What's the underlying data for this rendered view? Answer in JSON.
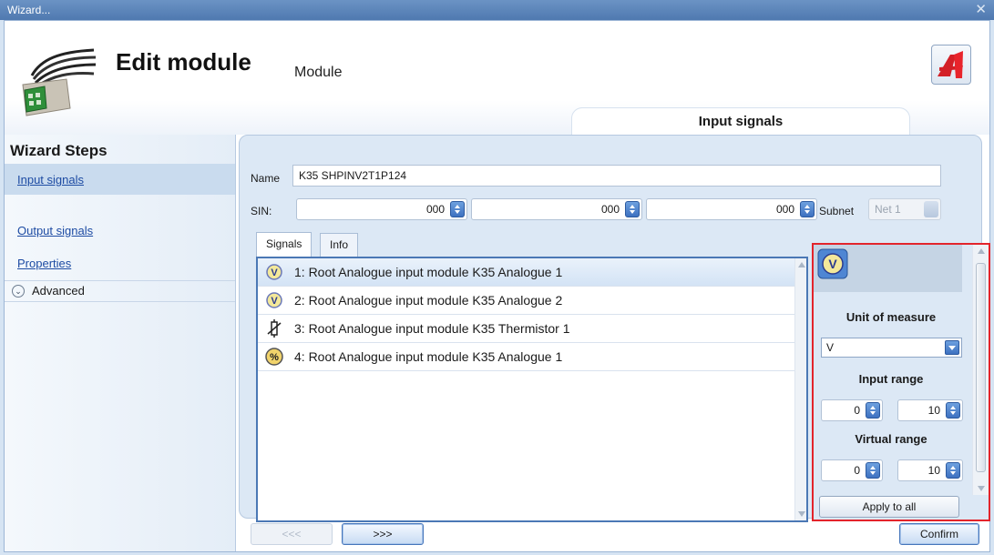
{
  "window": {
    "title": "Wizard...",
    "close_glyph": "✕"
  },
  "header": {
    "title": "Edit module",
    "subtitle": "Module",
    "page_tab": "Input signals"
  },
  "sidebar": {
    "heading": "Wizard Steps",
    "steps": [
      {
        "label": "Input signals",
        "active": true
      },
      {
        "label": "Output signals",
        "active": false
      },
      {
        "label": "Properties",
        "active": false
      }
    ],
    "advanced": "Advanced"
  },
  "form": {
    "name_label": "Name",
    "name_value": "K35 SHPINV2T1P124",
    "sin_label": "SIN:",
    "sin_values": [
      "000",
      "000",
      "000"
    ],
    "subnet_label": "Subnet",
    "subnet_value": "Net 1"
  },
  "tabs": {
    "signals": "Signals",
    "info": "Info"
  },
  "signals": [
    {
      "label": "1: Root Analogue input module K35 Analogue 1",
      "icon": "voltage-icon",
      "selected": true
    },
    {
      "label": "2: Root Analogue input module K35 Analogue 2",
      "icon": "voltage-icon",
      "selected": false
    },
    {
      "label": "3: Root Analogue input module K35 Thermistor 1",
      "icon": "thermistor-icon",
      "selected": false
    },
    {
      "label": "4: Root Analogue input module K35 Analogue 1",
      "icon": "percent-icon",
      "selected": false
    }
  ],
  "properties": {
    "unit_heading": "Unit of measure",
    "unit_value": "V",
    "input_range_heading": "Input range",
    "input_min": "0",
    "input_max": "10",
    "virtual_range_heading": "Virtual range",
    "virtual_min": "0",
    "virtual_max": "10",
    "apply_label": "Apply to all"
  },
  "footer": {
    "back_label": "<<<",
    "next_label": ">>>",
    "confirm_label": "Confirm"
  },
  "colors": {
    "highlight_border": "#e3242b",
    "accent": "#3d71c0"
  }
}
